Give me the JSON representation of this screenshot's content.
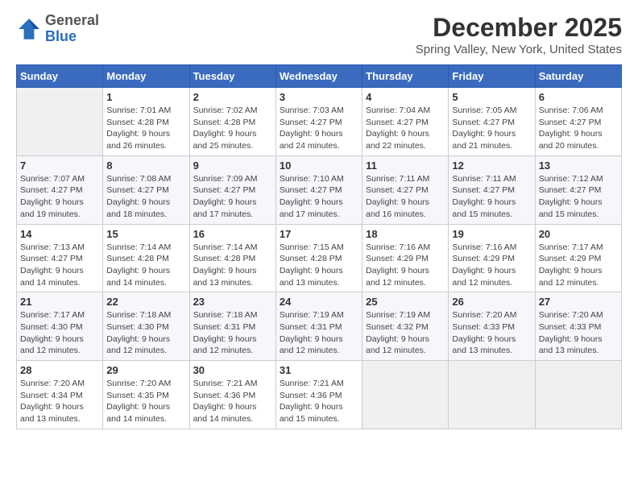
{
  "logo": {
    "general": "General",
    "blue": "Blue"
  },
  "title": "December 2025",
  "subtitle": "Spring Valley, New York, United States",
  "days_header": [
    "Sunday",
    "Monday",
    "Tuesday",
    "Wednesday",
    "Thursday",
    "Friday",
    "Saturday"
  ],
  "weeks": [
    [
      {
        "num": "",
        "info": ""
      },
      {
        "num": "1",
        "info": "Sunrise: 7:01 AM\nSunset: 4:28 PM\nDaylight: 9 hours\nand 26 minutes."
      },
      {
        "num": "2",
        "info": "Sunrise: 7:02 AM\nSunset: 4:28 PM\nDaylight: 9 hours\nand 25 minutes."
      },
      {
        "num": "3",
        "info": "Sunrise: 7:03 AM\nSunset: 4:27 PM\nDaylight: 9 hours\nand 24 minutes."
      },
      {
        "num": "4",
        "info": "Sunrise: 7:04 AM\nSunset: 4:27 PM\nDaylight: 9 hours\nand 22 minutes."
      },
      {
        "num": "5",
        "info": "Sunrise: 7:05 AM\nSunset: 4:27 PM\nDaylight: 9 hours\nand 21 minutes."
      },
      {
        "num": "6",
        "info": "Sunrise: 7:06 AM\nSunset: 4:27 PM\nDaylight: 9 hours\nand 20 minutes."
      }
    ],
    [
      {
        "num": "7",
        "info": "Sunrise: 7:07 AM\nSunset: 4:27 PM\nDaylight: 9 hours\nand 19 minutes."
      },
      {
        "num": "8",
        "info": "Sunrise: 7:08 AM\nSunset: 4:27 PM\nDaylight: 9 hours\nand 18 minutes."
      },
      {
        "num": "9",
        "info": "Sunrise: 7:09 AM\nSunset: 4:27 PM\nDaylight: 9 hours\nand 17 minutes."
      },
      {
        "num": "10",
        "info": "Sunrise: 7:10 AM\nSunset: 4:27 PM\nDaylight: 9 hours\nand 17 minutes."
      },
      {
        "num": "11",
        "info": "Sunrise: 7:11 AM\nSunset: 4:27 PM\nDaylight: 9 hours\nand 16 minutes."
      },
      {
        "num": "12",
        "info": "Sunrise: 7:11 AM\nSunset: 4:27 PM\nDaylight: 9 hours\nand 15 minutes."
      },
      {
        "num": "13",
        "info": "Sunrise: 7:12 AM\nSunset: 4:27 PM\nDaylight: 9 hours\nand 15 minutes."
      }
    ],
    [
      {
        "num": "14",
        "info": "Sunrise: 7:13 AM\nSunset: 4:27 PM\nDaylight: 9 hours\nand 14 minutes."
      },
      {
        "num": "15",
        "info": "Sunrise: 7:14 AM\nSunset: 4:28 PM\nDaylight: 9 hours\nand 14 minutes."
      },
      {
        "num": "16",
        "info": "Sunrise: 7:14 AM\nSunset: 4:28 PM\nDaylight: 9 hours\nand 13 minutes."
      },
      {
        "num": "17",
        "info": "Sunrise: 7:15 AM\nSunset: 4:28 PM\nDaylight: 9 hours\nand 13 minutes."
      },
      {
        "num": "18",
        "info": "Sunrise: 7:16 AM\nSunset: 4:29 PM\nDaylight: 9 hours\nand 12 minutes."
      },
      {
        "num": "19",
        "info": "Sunrise: 7:16 AM\nSunset: 4:29 PM\nDaylight: 9 hours\nand 12 minutes."
      },
      {
        "num": "20",
        "info": "Sunrise: 7:17 AM\nSunset: 4:29 PM\nDaylight: 9 hours\nand 12 minutes."
      }
    ],
    [
      {
        "num": "21",
        "info": "Sunrise: 7:17 AM\nSunset: 4:30 PM\nDaylight: 9 hours\nand 12 minutes."
      },
      {
        "num": "22",
        "info": "Sunrise: 7:18 AM\nSunset: 4:30 PM\nDaylight: 9 hours\nand 12 minutes."
      },
      {
        "num": "23",
        "info": "Sunrise: 7:18 AM\nSunset: 4:31 PM\nDaylight: 9 hours\nand 12 minutes."
      },
      {
        "num": "24",
        "info": "Sunrise: 7:19 AM\nSunset: 4:31 PM\nDaylight: 9 hours\nand 12 minutes."
      },
      {
        "num": "25",
        "info": "Sunrise: 7:19 AM\nSunset: 4:32 PM\nDaylight: 9 hours\nand 12 minutes."
      },
      {
        "num": "26",
        "info": "Sunrise: 7:20 AM\nSunset: 4:33 PM\nDaylight: 9 hours\nand 13 minutes."
      },
      {
        "num": "27",
        "info": "Sunrise: 7:20 AM\nSunset: 4:33 PM\nDaylight: 9 hours\nand 13 minutes."
      }
    ],
    [
      {
        "num": "28",
        "info": "Sunrise: 7:20 AM\nSunset: 4:34 PM\nDaylight: 9 hours\nand 13 minutes."
      },
      {
        "num": "29",
        "info": "Sunrise: 7:20 AM\nSunset: 4:35 PM\nDaylight: 9 hours\nand 14 minutes."
      },
      {
        "num": "30",
        "info": "Sunrise: 7:21 AM\nSunset: 4:36 PM\nDaylight: 9 hours\nand 14 minutes."
      },
      {
        "num": "31",
        "info": "Sunrise: 7:21 AM\nSunset: 4:36 PM\nDaylight: 9 hours\nand 15 minutes."
      },
      {
        "num": "",
        "info": ""
      },
      {
        "num": "",
        "info": ""
      },
      {
        "num": "",
        "info": ""
      }
    ]
  ]
}
